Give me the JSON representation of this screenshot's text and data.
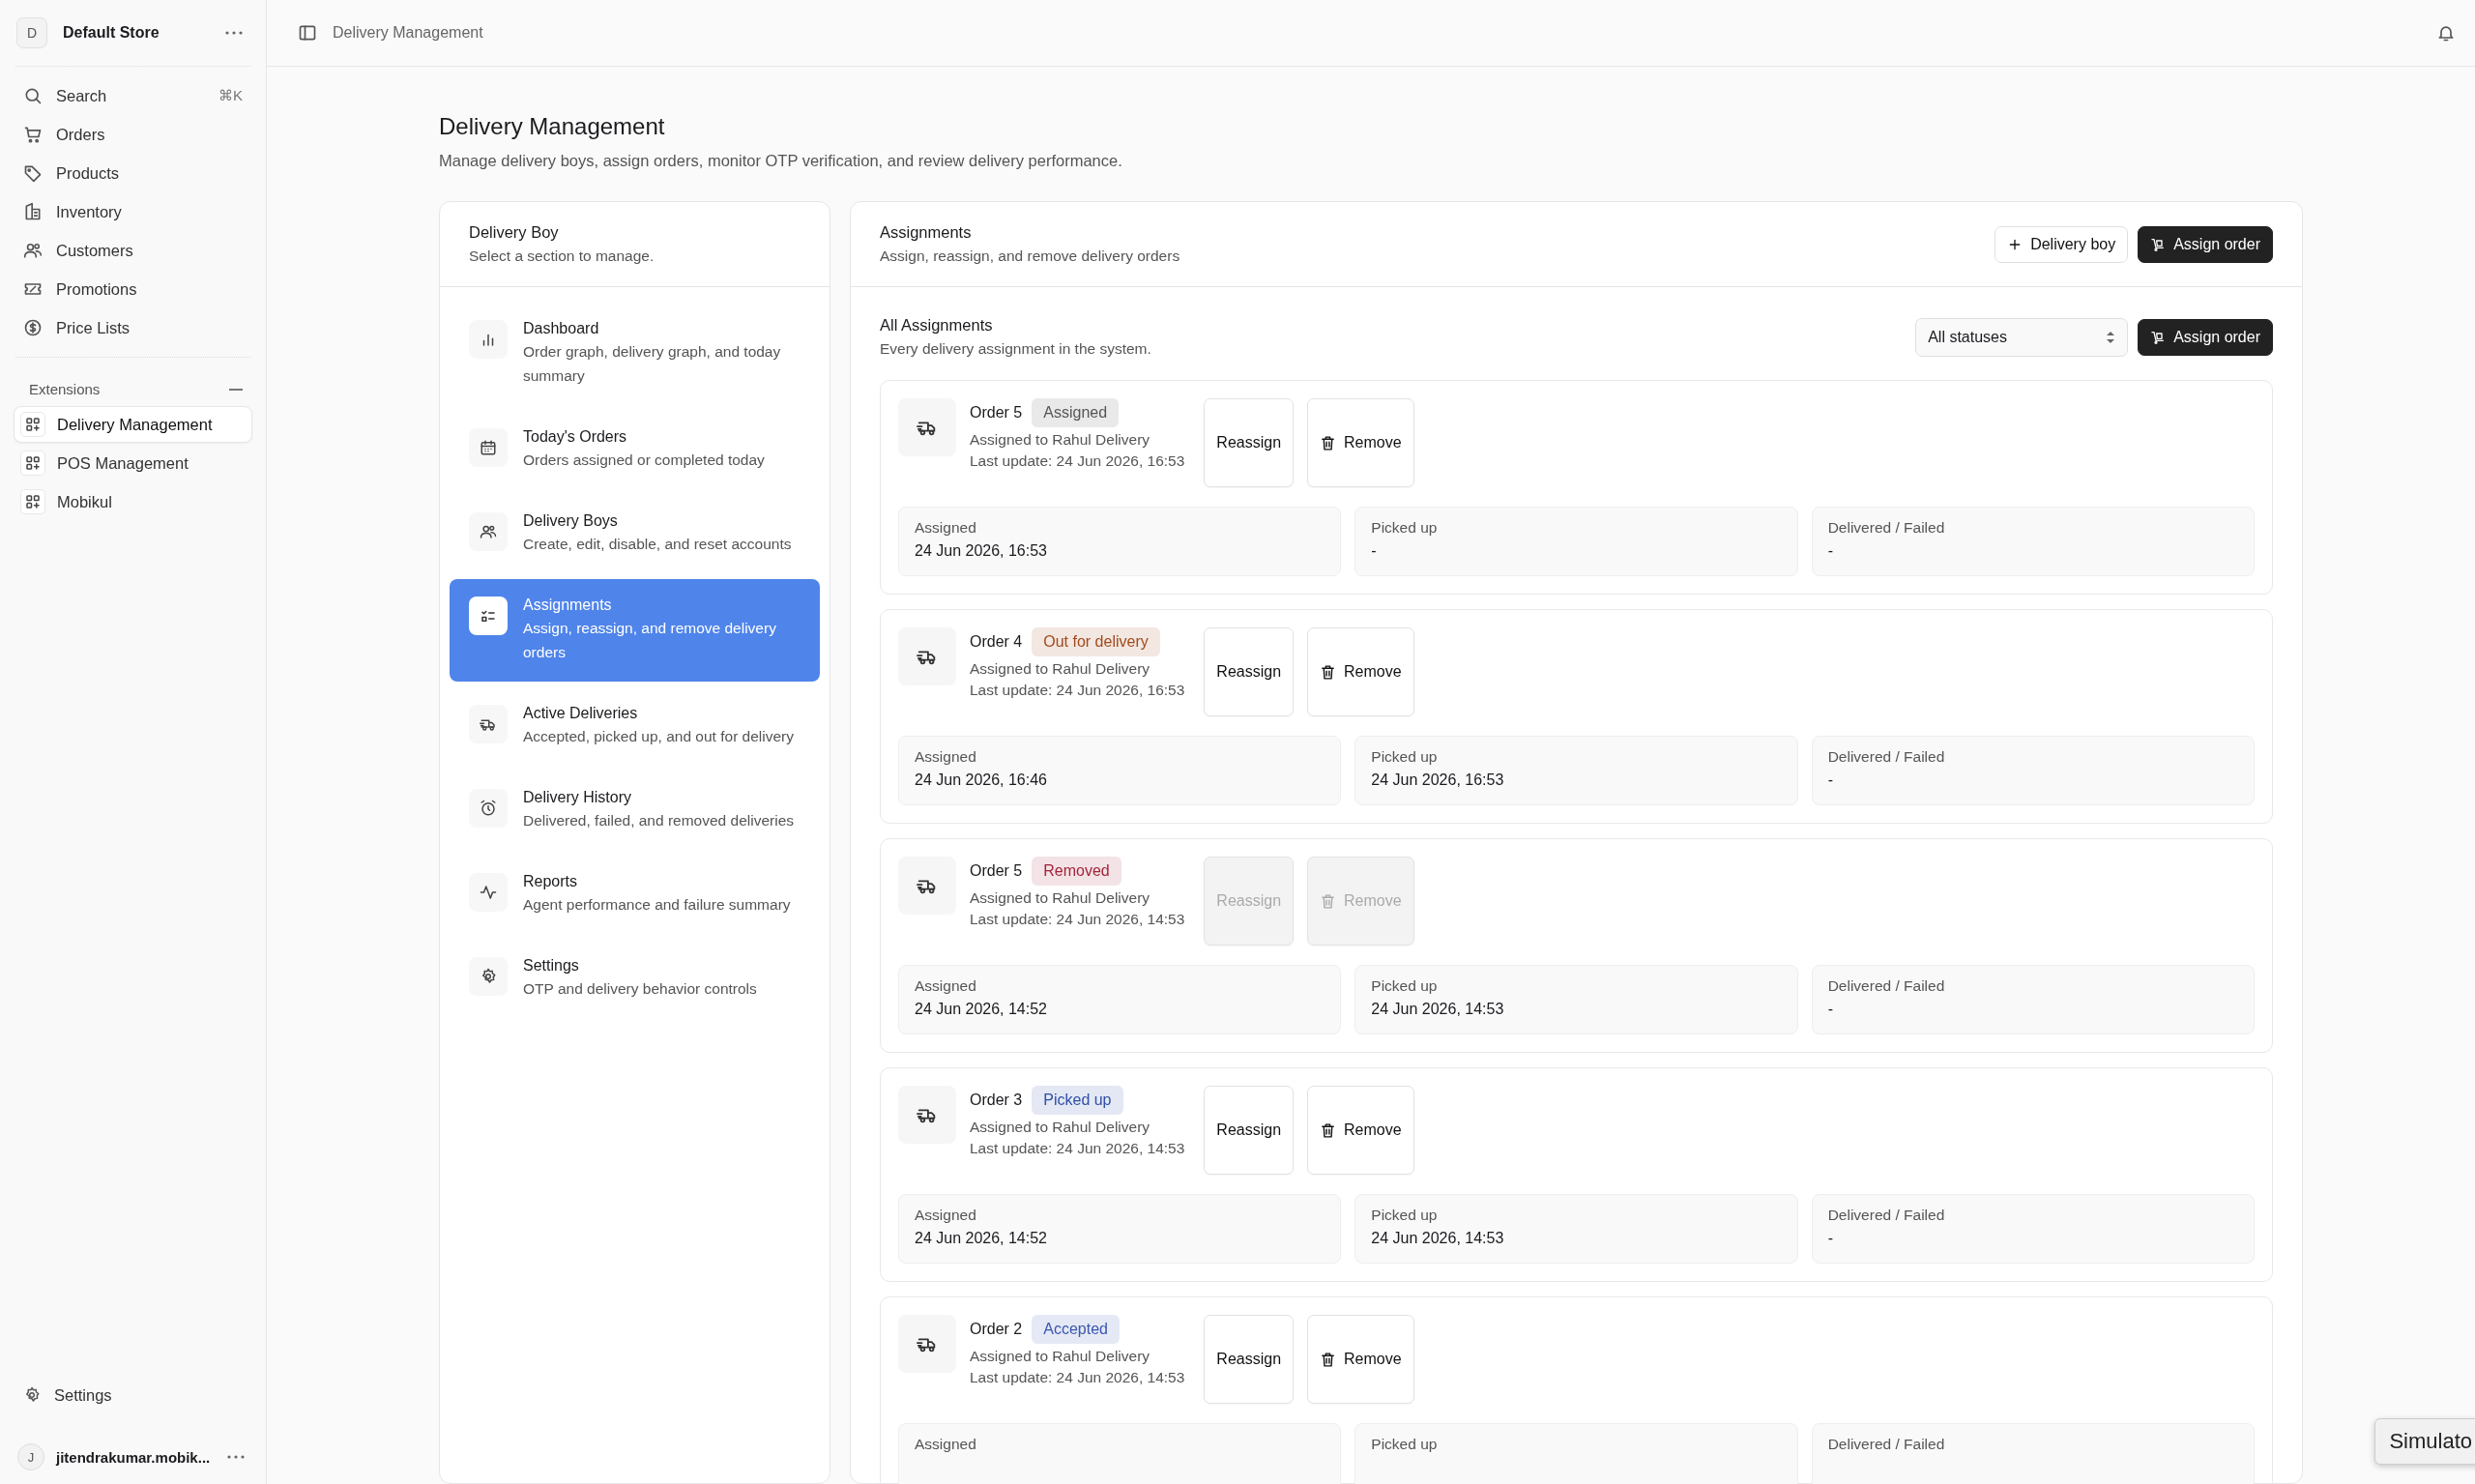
{
  "sidebar": {
    "store": {
      "initial": "D",
      "name": "Default Store"
    },
    "nav": [
      {
        "label": "Search",
        "shortcut": "⌘K"
      },
      {
        "label": "Orders"
      },
      {
        "label": "Products"
      },
      {
        "label": "Inventory"
      },
      {
        "label": "Customers"
      },
      {
        "label": "Promotions"
      },
      {
        "label": "Price Lists"
      }
    ],
    "extensions": {
      "title": "Extensions",
      "items": [
        {
          "label": "Delivery Management",
          "selected": true
        },
        {
          "label": "POS Management",
          "selected": false
        },
        {
          "label": "Mobikul",
          "selected": false
        }
      ]
    },
    "settings": "Settings",
    "user": {
      "initial": "J",
      "name": "jitendrakumar.mobik..."
    }
  },
  "topbar": {
    "breadcrumb": "Delivery Management"
  },
  "page": {
    "title": "Delivery Management",
    "subtitle": "Manage delivery boys, assign orders, monitor OTP verification, and review delivery performance."
  },
  "sections": {
    "title": "Delivery Boy",
    "subtitle": "Select a section to manage.",
    "items": [
      {
        "title": "Dashboard",
        "description": "Order graph, delivery graph, and today summary",
        "selected": false
      },
      {
        "title": "Today's Orders",
        "description": "Orders assigned or completed today",
        "selected": false
      },
      {
        "title": "Delivery Boys",
        "description": "Create, edit, disable, and reset accounts",
        "selected": false
      },
      {
        "title": "Assignments",
        "description": "Assign, reassign, and remove delivery orders",
        "selected": true
      },
      {
        "title": "Active Deliveries",
        "description": "Accepted, picked up, and out for delivery",
        "selected": false
      },
      {
        "title": "Delivery History",
        "description": "Delivered, failed, and removed deliveries",
        "selected": false
      },
      {
        "title": "Reports",
        "description": "Agent performance and failure summary",
        "selected": false
      },
      {
        "title": "Settings",
        "description": "OTP and delivery behavior controls",
        "selected": false
      }
    ]
  },
  "assignments": {
    "title": "Assignments",
    "subtitle": "Assign, reassign, and remove delivery orders",
    "buttons": [
      {
        "label": "Delivery boy",
        "kind": "add"
      },
      {
        "label": "Assign order",
        "kind": "assign"
      }
    ],
    "list": {
      "title": "All Assignments",
      "subtitle": "Every delivery assignment in the system.",
      "filter": "All statuses",
      "button": "Assign order"
    },
    "orders": [
      {
        "title": "Order 5",
        "status": "Assigned",
        "color": "#555555",
        "assignee": "Assigned to Rahul Delivery",
        "updated": "Last update: 24 Jun 2026, 16:53",
        "actions": [
          {
            "label": "Reassign",
            "kind": "plain",
            "disabled": false
          },
          {
            "label": "Remove",
            "kind": "delete",
            "disabled": false
          }
        ],
        "stats": [
          {
            "label": "Assigned",
            "value": "24 Jun 2026, 16:53"
          },
          {
            "label": "Picked up",
            "value": "-"
          },
          {
            "label": "Delivered / Failed",
            "value": "-"
          }
        ]
      },
      {
        "title": "Order 4",
        "status": "Out for delivery",
        "color": "#a14a1c",
        "assignee": "Assigned to Rahul Delivery",
        "updated": "Last update: 24 Jun 2026, 16:53",
        "actions": [
          {
            "label": "Reassign",
            "kind": "plain",
            "disabled": false
          },
          {
            "label": "Remove",
            "kind": "delete",
            "disabled": false
          }
        ],
        "stats": [
          {
            "label": "Assigned",
            "value": "24 Jun 2026, 16:46"
          },
          {
            "label": "Picked up",
            "value": "24 Jun 2026, 16:53"
          },
          {
            "label": "Delivered / Failed",
            "value": "-"
          }
        ]
      },
      {
        "title": "Order 5",
        "status": "Removed",
        "color": "#a3243b",
        "assignee": "Assigned to Rahul Delivery",
        "updated": "Last update: 24 Jun 2026, 14:53",
        "actions": [
          {
            "label": "Reassign",
            "kind": "plain",
            "disabled": true
          },
          {
            "label": "Remove",
            "kind": "delete",
            "disabled": true
          }
        ],
        "stats": [
          {
            "label": "Assigned",
            "value": "24 Jun 2026, 14:52"
          },
          {
            "label": "Picked up",
            "value": "24 Jun 2026, 14:53"
          },
          {
            "label": "Delivered / Failed",
            "value": "-"
          }
        ]
      },
      {
        "title": "Order 3",
        "status": "Picked up",
        "color": "#2f4fa8",
        "assignee": "Assigned to Rahul Delivery",
        "updated": "Last update: 24 Jun 2026, 14:53",
        "actions": [
          {
            "label": "Reassign",
            "kind": "plain",
            "disabled": false
          },
          {
            "label": "Remove",
            "kind": "delete",
            "disabled": false
          }
        ],
        "stats": [
          {
            "label": "Assigned",
            "value": "24 Jun 2026, 14:52"
          },
          {
            "label": "Picked up",
            "value": "24 Jun 2026, 14:53"
          },
          {
            "label": "Delivered / Failed",
            "value": "-"
          }
        ]
      },
      {
        "title": "Order 2",
        "status": "Accepted",
        "color": "#3a56b0",
        "assignee": "Assigned to Rahul Delivery",
        "updated": "Last update: 24 Jun 2026, 14:53",
        "actions": [
          {
            "label": "Reassign",
            "kind": "plain",
            "disabled": false
          },
          {
            "label": "Remove",
            "kind": "delete",
            "disabled": false
          }
        ],
        "stats": [
          {
            "label": "Assigned"
          },
          {
            "label": "Picked up"
          },
          {
            "label": "Delivered / Failed"
          }
        ]
      }
    ]
  },
  "tooltip": "Simulato"
}
